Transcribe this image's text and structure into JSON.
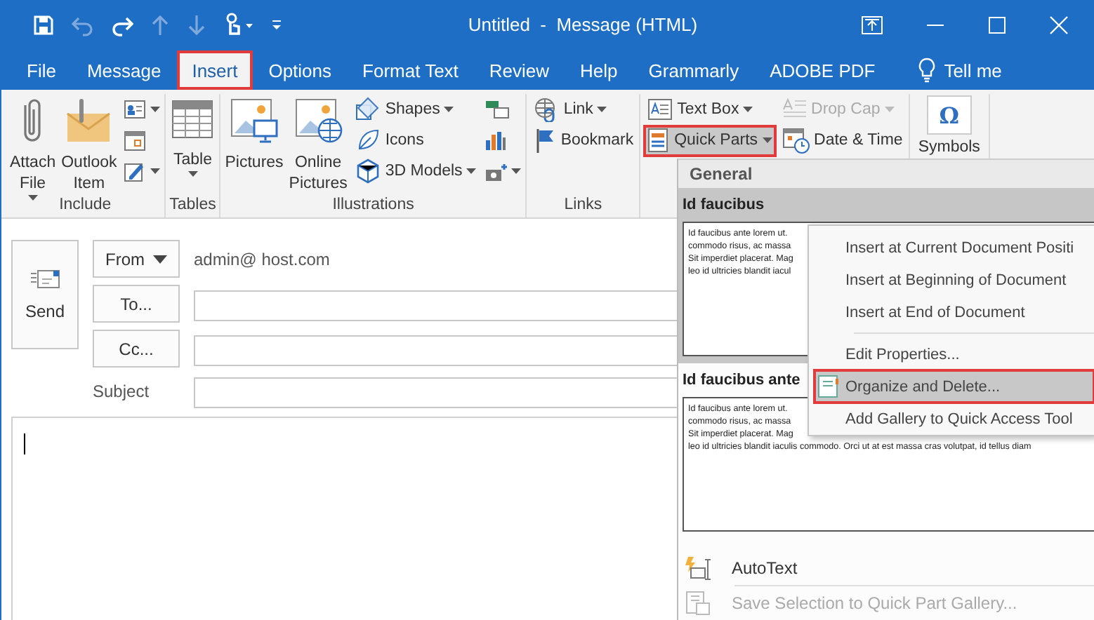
{
  "window": {
    "title": "Untitled  -  Message (HTML)"
  },
  "tabs": [
    {
      "label": "File",
      "selected": false,
      "highlighted": false
    },
    {
      "label": "Message",
      "selected": false,
      "highlighted": false
    },
    {
      "label": "Insert",
      "selected": true,
      "highlighted": true
    },
    {
      "label": "Options",
      "selected": false,
      "highlighted": false
    },
    {
      "label": "Format Text",
      "selected": false,
      "highlighted": false
    },
    {
      "label": "Review",
      "selected": false,
      "highlighted": false
    },
    {
      "label": "Help",
      "selected": false,
      "highlighted": false
    },
    {
      "label": "Grammarly",
      "selected": false,
      "highlighted": false
    },
    {
      "label": "ADOBE PDF",
      "selected": false,
      "highlighted": false
    }
  ],
  "tell_me": "Tell me",
  "ribbon": {
    "groups": [
      {
        "label": "Include",
        "items": [
          {
            "kind": "large",
            "label": "Attach File",
            "dropdown": true
          },
          {
            "kind": "large",
            "label": "Outlook Item",
            "dropdown": false
          },
          {
            "kind": "icon",
            "dropdown": true
          },
          {
            "kind": "icon",
            "dropdown": false
          },
          {
            "kind": "icon",
            "dropdown": true
          }
        ]
      },
      {
        "label": "Tables",
        "items": [
          {
            "kind": "large",
            "label": "Table",
            "dropdown": true
          }
        ]
      },
      {
        "label": "Illustrations",
        "items": [
          {
            "kind": "large",
            "label": "Pictures",
            "dropdown": false
          },
          {
            "kind": "large",
            "label": "Online Pictures",
            "dropdown": false
          },
          {
            "kind": "small",
            "label": "Shapes",
            "dropdown": true
          },
          {
            "kind": "small",
            "label": "Icons",
            "dropdown": false
          },
          {
            "kind": "small",
            "label": "3D Models",
            "dropdown": true
          },
          {
            "kind": "icon",
            "dropdown": false
          },
          {
            "kind": "icon",
            "dropdown": false
          },
          {
            "kind": "icon",
            "dropdown": true
          }
        ]
      },
      {
        "label": "Links",
        "items": [
          {
            "kind": "small",
            "label": "Link",
            "dropdown": true
          },
          {
            "kind": "small",
            "label": "Bookmark",
            "dropdown": false
          }
        ]
      },
      {
        "items": [
          {
            "kind": "small",
            "label": "Text Box",
            "dropdown": true,
            "disabled": false,
            "pressed": false,
            "highlighted": false
          },
          {
            "kind": "small",
            "label": "Quick Parts",
            "dropdown": true,
            "disabled": false,
            "pressed": true,
            "highlighted": true
          },
          {
            "kind": "small",
            "label": "Drop Cap",
            "dropdown": true,
            "disabled": true,
            "pressed": false,
            "highlighted": false
          },
          {
            "kind": "small",
            "label": "Date & Time",
            "dropdown": false,
            "disabled": false,
            "pressed": false,
            "highlighted": false
          }
        ]
      },
      {
        "items": [
          {
            "kind": "glyph",
            "glyph": "Ω",
            "label": "Symbols",
            "dropdown": false
          }
        ]
      }
    ]
  },
  "compose": {
    "send": "Send",
    "from_button": "From",
    "from_address": "admin@ host.com",
    "to_button": "To...",
    "cc_button": "Cc...",
    "subject_label": "Subject"
  },
  "gallery": {
    "header": "General",
    "entries": [
      {
        "title": "Id faucibus",
        "selected": true,
        "preview": [
          "Id faucibus ante lorem ut.",
          "commodo risus, ac massa",
          "Sit imperdiet placerat. Mag",
          "leo id ultricies blandit iacul"
        ]
      },
      {
        "title": "Id faucibus ante",
        "selected": false,
        "preview": [
          "Id faucibus ante lorem ut.",
          "commodo risus, ac massa",
          "Sit imperdiet placerat. Mag",
          "leo id ultricies blandit iaculis commodo. Orci ut at est massa cras volutpat, id tellus diam"
        ]
      }
    ],
    "commands": [
      {
        "label": "AutoText",
        "disabled": false
      },
      {
        "label": "Save Selection to Quick Part Gallery...",
        "disabled": true
      }
    ]
  },
  "context_menu": {
    "items": [
      {
        "kind": "item",
        "label": "Insert at Current Document Positi",
        "hover": false,
        "highlighted": false
      },
      {
        "kind": "item",
        "label": "Insert at Beginning of Document",
        "hover": false,
        "highlighted": false
      },
      {
        "kind": "item",
        "label": "Insert at End of Document",
        "hover": false,
        "highlighted": false
      },
      {
        "kind": "separator"
      },
      {
        "kind": "item",
        "label": "Edit Properties...",
        "hover": false,
        "highlighted": false
      },
      {
        "kind": "item",
        "label": "Organize and Delete...",
        "hover": true,
        "highlighted": true
      },
      {
        "kind": "item",
        "label": "Add Gallery to Quick Access Tool",
        "hover": false,
        "highlighted": false
      }
    ]
  }
}
